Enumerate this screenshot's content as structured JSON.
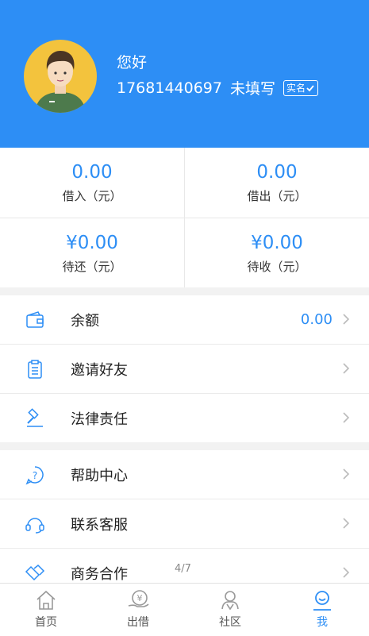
{
  "profile": {
    "greeting": "您好",
    "phone": "17681440697",
    "name_status": "未填写",
    "verify_badge": "实名"
  },
  "stats": [
    {
      "value": "0.00",
      "label": "借入（元）"
    },
    {
      "value": "0.00",
      "label": "借出（元）"
    },
    {
      "value": "¥0.00",
      "label": "待还（元）"
    },
    {
      "value": "¥0.00",
      "label": "待收（元）"
    }
  ],
  "menu_group_1": [
    {
      "label": "余额",
      "value": "0.00",
      "icon": "wallet-icon"
    },
    {
      "label": "邀请好友",
      "icon": "clipboard-icon"
    },
    {
      "label": "法律责任",
      "icon": "gavel-icon"
    }
  ],
  "menu_group_2": [
    {
      "label": "帮助中心",
      "icon": "help-icon"
    },
    {
      "label": "联系客服",
      "icon": "headset-icon"
    },
    {
      "label": "商务合作",
      "icon": "handshake-icon"
    }
  ],
  "pager": "4/7",
  "tabs": [
    {
      "label": "首页",
      "icon": "home-icon"
    },
    {
      "label": "出借",
      "icon": "lend-icon"
    },
    {
      "label": "社区",
      "icon": "community-icon"
    },
    {
      "label": "我",
      "icon": "me-icon",
      "active": true
    }
  ],
  "colors": {
    "accent": "#2d8ef5",
    "avatar_bg": "#f3c33d"
  }
}
